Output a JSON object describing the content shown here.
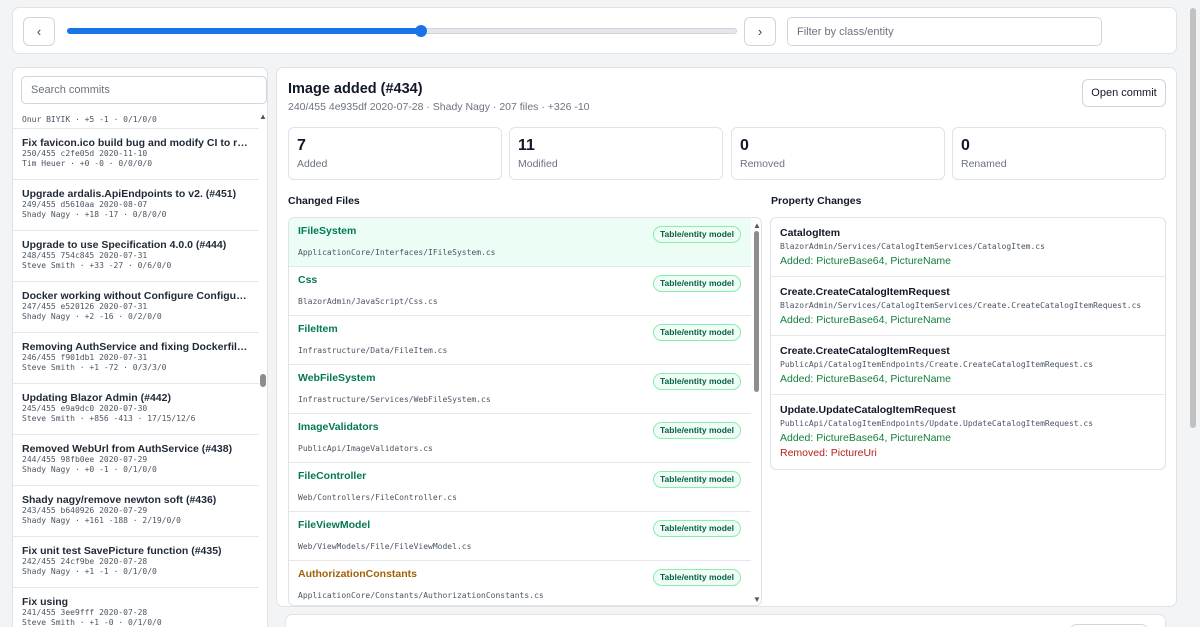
{
  "nav": {
    "prev_icon": "‹",
    "next_icon": "›",
    "position_percent": 52.8,
    "filter_placeholder": "Filter by class/entity"
  },
  "commits": {
    "search_placeholder": "Search commits",
    "items": [
      {
        "title": "",
        "meta1": "Onur BIYIK · +5 -1 · 0/1/0/0",
        "meta2": ""
      },
      {
        "title": "Fix favicon.ico build bug and modify CI to ru...",
        "meta1": "250/455 c2fe05d 2020-11-10",
        "meta2": "Tim Heuer · +0 -0 · 0/0/0/0"
      },
      {
        "title": "Upgrade ardalis.ApiEndpoints to v2. (#451)",
        "meta1": "249/455 d5610aa 2020-08-07",
        "meta2": "Shady Nagy · +18 -17 · 0/8/0/0"
      },
      {
        "title": "Upgrade to use Specification 4.0.0 (#444)",
        "meta1": "248/455 754c845 2020-07-31",
        "meta2": "Steve Smith · +33 -27 · 0/6/0/0"
      },
      {
        "title": "Docker working without Configure Configure...",
        "meta1": "247/455 e520126 2020-07-31",
        "meta2": "Shady Nagy · +2 -16 · 0/2/0/0"
      },
      {
        "title": "Removing AuthService and fixing Dockerfile ...",
        "meta1": "246/455 f901db1 2020-07-31",
        "meta2": "Steve Smith · +1 -72 · 0/3/3/0"
      },
      {
        "title": "Updating Blazor Admin (#442)",
        "meta1": "245/455 e9a9dc0 2020-07-30",
        "meta2": "Steve Smith · +856 -413 · 17/15/12/6"
      },
      {
        "title": "Removed WebUrl from AuthService (#438)",
        "meta1": "244/455 98fb0ee 2020-07-29",
        "meta2": "Shady Nagy · +0 -1 · 0/1/0/0"
      },
      {
        "title": "Shady nagy/remove newton soft (#436)",
        "meta1": "243/455 b640926 2020-07-29",
        "meta2": "Shady Nagy · +161 -188 · 2/19/0/0"
      },
      {
        "title": "Fix unit test SavePicture function (#435)",
        "meta1": "242/455 24cf9be 2020-07-28",
        "meta2": "Shady Nagy · +1 -1 · 0/1/0/0"
      },
      {
        "title": "Fix using",
        "meta1": "241/455 3ee9fff 2020-07-28",
        "meta2": "Steve Smith · +1 -0 · 0/1/0/0"
      }
    ]
  },
  "commit": {
    "title": "Image added (#434)",
    "meta": "240/455 4e935df 2020-07-28 · Shady Nagy · 207 files · +326 -10",
    "open_label": "Open commit",
    "stats": [
      {
        "value": "7",
        "label": "Added"
      },
      {
        "value": "11",
        "label": "Modified"
      },
      {
        "value": "0",
        "label": "Removed"
      },
      {
        "value": "0",
        "label": "Renamed"
      }
    ]
  },
  "changed_files": {
    "heading": "Changed Files",
    "items": [
      {
        "name": "IFileSystem",
        "path": "ApplicationCore/Interfaces/IFileSystem.cs",
        "badge": "Table/entity model",
        "color": "#047857"
      },
      {
        "name": "Css",
        "path": "BlazorAdmin/JavaScript/Css.cs",
        "badge": "Table/entity model",
        "color": "#047857"
      },
      {
        "name": "FileItem",
        "path": "Infrastructure/Data/FileItem.cs",
        "badge": "Table/entity model",
        "color": "#047857"
      },
      {
        "name": "WebFileSystem",
        "path": "Infrastructure/Services/WebFileSystem.cs",
        "badge": "Table/entity model",
        "color": "#047857"
      },
      {
        "name": "ImageValidators",
        "path": "PublicApi/ImageValidators.cs",
        "badge": "Table/entity model",
        "color": "#047857"
      },
      {
        "name": "FileController",
        "path": "Web/Controllers/FileController.cs",
        "badge": "Table/entity model",
        "color": "#047857"
      },
      {
        "name": "FileViewModel",
        "path": "Web/ViewModels/File/FileViewModel.cs",
        "badge": "Table/entity model",
        "color": "#047857"
      },
      {
        "name": "AuthorizationConstants",
        "path": "ApplicationCore/Constants/AuthorizationConstants.cs",
        "badge": "Table/entity model",
        "color": "#a16207"
      }
    ]
  },
  "property_changes": {
    "heading": "Property Changes",
    "items": [
      {
        "name": "CatalogItem",
        "path": "BlazorAdmin/Services/CatalogItemServices/CatalogItem.cs",
        "added": "Added: PictureBase64, PictureName",
        "removed": ""
      },
      {
        "name": "Create.CreateCatalogItemRequest",
        "path": "BlazorAdmin/Services/CatalogItemServices/Create.CreateCatalogItemRequest.cs",
        "added": "Added: PictureBase64, PictureName",
        "removed": ""
      },
      {
        "name": "Create.CreateCatalogItemRequest",
        "path": "PublicApi/CatalogItemEndpoints/Create.CreateCatalogItemRequest.cs",
        "added": "Added: PictureBase64, PictureName",
        "removed": ""
      },
      {
        "name": "Update.UpdateCatalogItemRequest",
        "path": "PublicApi/CatalogItemEndpoints/Update.UpdateCatalogItemRequest.cs",
        "added": "Added: PictureBase64, PictureName",
        "removed": "Removed: PictureUri"
      }
    ]
  },
  "colors": {
    "accent": "#1a73e8",
    "added": "#15803d",
    "removed": "#b91c1c",
    "selected_row": "#ecfdf5"
  }
}
